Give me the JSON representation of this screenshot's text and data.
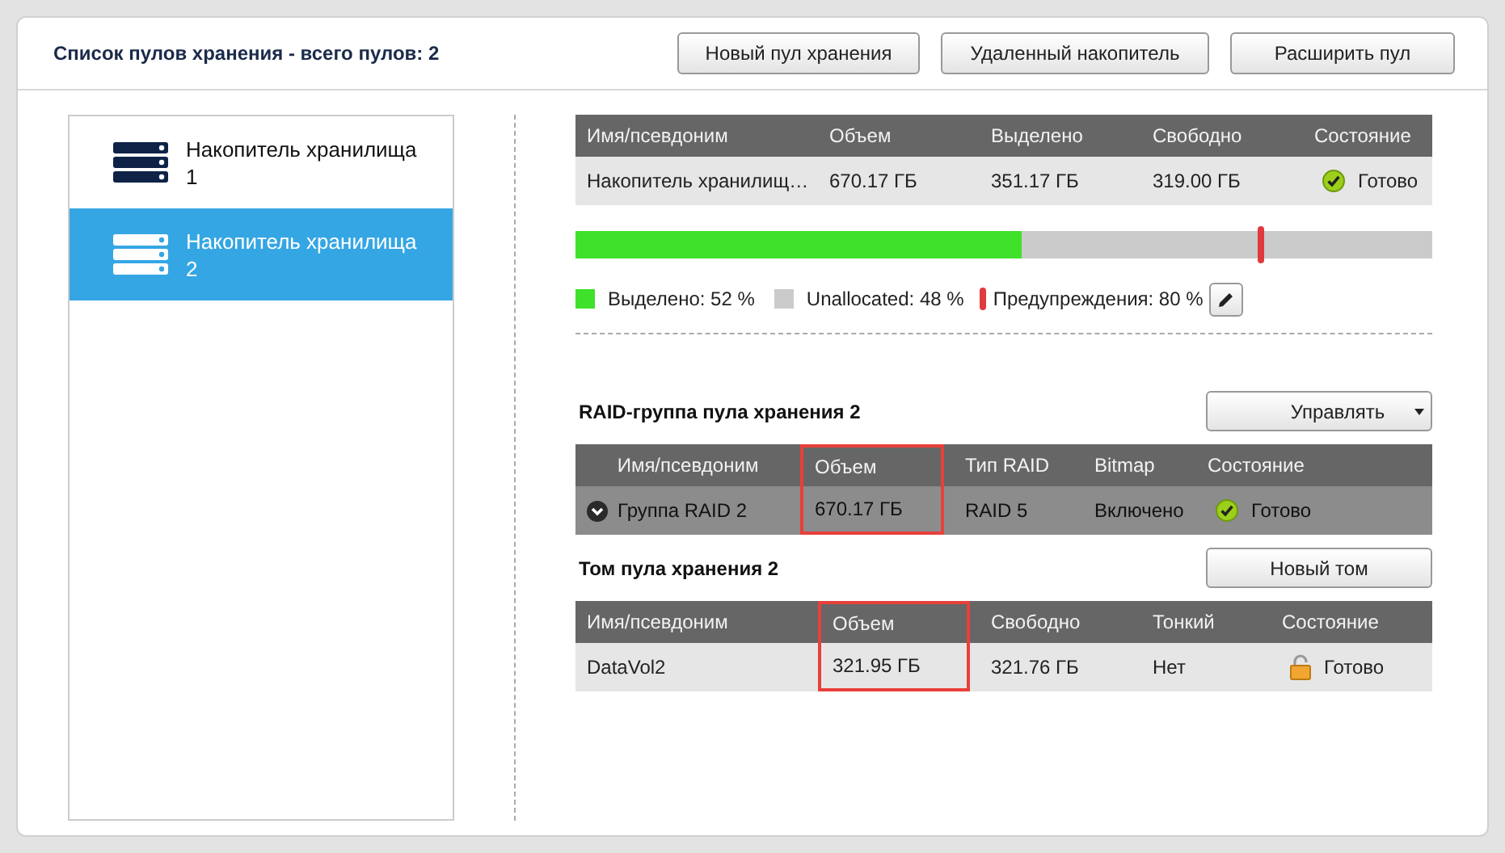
{
  "header": {
    "title": "Список пулов хранения - всего пулов: 2",
    "buttons": [
      "Новый пул хранения",
      "Удаленный накопитель",
      "Расширить пул"
    ]
  },
  "pools": [
    {
      "label": "Накопитель хранилища 1",
      "selected": false
    },
    {
      "label": "Накопитель хранилища 2",
      "selected": true
    }
  ],
  "pool_table": {
    "columns": [
      {
        "label": "Имя/псевдоним",
        "highlighted": false
      },
      {
        "label": "Объем",
        "highlighted": false
      },
      {
        "label": "Выделено",
        "highlighted": false
      },
      {
        "label": "Свободно",
        "highlighted": false
      },
      {
        "label": "Состояние",
        "highlighted": false
      }
    ],
    "rows": [
      {
        "cells": [
          "Накопитель хранилищ…",
          "670.17 ГБ",
          "351.17 ГБ",
          "319.00 ГБ"
        ],
        "status": {
          "kind": "ok",
          "text": "Готово"
        }
      }
    ]
  },
  "usage_bar": {
    "level": 0.52,
    "threshold": {
      "level": 0.8
    }
  },
  "legend": [
    {
      "kind": "allocated",
      "text": "Выделено: 52 %"
    },
    {
      "kind": "free",
      "text": "Unallocated: 48 %"
    },
    {
      "kind": "threshold",
      "text": "Предупреждения: 80 %"
    }
  ],
  "raid_section": {
    "title": "RAID-группа пула хранения 2",
    "button": "Управлять"
  },
  "raid_table": {
    "columns": [
      {
        "label": "Имя/псевдоним",
        "highlighted": false
      },
      {
        "label": "Объем",
        "highlighted": true
      },
      {
        "label": "Тип RAID",
        "highlighted": false
      },
      {
        "label": "Bitmap",
        "highlighted": false
      },
      {
        "label": "Состояние",
        "highlighted": false
      }
    ],
    "rows": [
      {
        "cells": [
          "Группа RAID 2",
          "670.17 ГБ",
          "RAID 5",
          "Включено"
        ],
        "expanded": false,
        "status": {
          "kind": "ok",
          "text": "Готово"
        }
      }
    ]
  },
  "volume_section": {
    "title": "Том пула хранения 2",
    "button": "Новый том"
  },
  "volume_table": {
    "columns": [
      {
        "label": "Имя/псевдоним",
        "highlighted": false
      },
      {
        "label": "Объем",
        "highlighted": true
      },
      {
        "label": "Свободно",
        "highlighted": false
      },
      {
        "label": "Тонкий",
        "highlighted": false
      },
      {
        "label": "Состояние",
        "highlighted": false
      }
    ],
    "rows": [
      {
        "cells": [
          "DataVol2",
          "321.95 ГБ",
          "321.76 ГБ",
          "Нет"
        ],
        "status": {
          "kind": "lock",
          "text": "Готово"
        }
      }
    ]
  }
}
